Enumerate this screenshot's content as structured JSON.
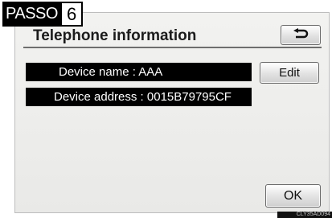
{
  "step": {
    "label": "PASSO",
    "number": "6"
  },
  "screen": {
    "title": "Telephone information",
    "back_icon": "back-arrow-icon",
    "device_name": "Device name : AAA",
    "device_address": "Device address : 0015B79795CF",
    "edit_label": "Edit",
    "ok_label": "OK"
  },
  "figure_code": "CLY35AD094"
}
